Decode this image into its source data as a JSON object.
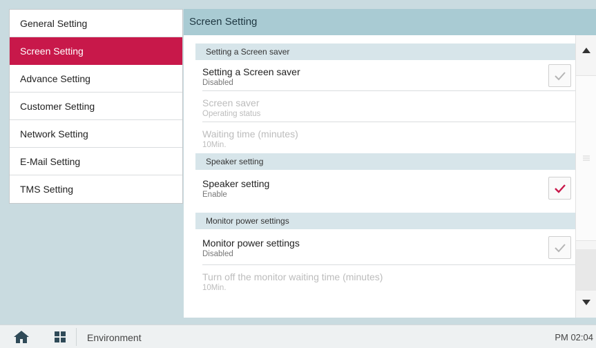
{
  "sidebar": {
    "items": [
      {
        "label": "General Setting",
        "active": false
      },
      {
        "label": "Screen Setting",
        "active": true
      },
      {
        "label": "Advance Setting",
        "active": false
      },
      {
        "label": "Customer Setting",
        "active": false
      },
      {
        "label": "Network Setting",
        "active": false
      },
      {
        "label": "E-Mail Setting",
        "active": false
      },
      {
        "label": "TMS Setting",
        "active": false
      }
    ]
  },
  "panel": {
    "title": "Screen Setting",
    "sections": [
      {
        "header": "Setting a Screen saver",
        "rows": [
          {
            "title": "Setting a Screen saver",
            "sub": "Disabled",
            "checkbox": true,
            "checked": false,
            "enabled": true
          },
          {
            "title": "Screen saver",
            "sub": "Operating status",
            "checkbox": false,
            "enabled": false
          },
          {
            "title": "Waiting time (minutes)",
            "sub": "10Min.",
            "checkbox": false,
            "enabled": false
          }
        ]
      },
      {
        "header": "Speaker setting",
        "rows": [
          {
            "title": "Speaker setting",
            "sub": "Enable",
            "checkbox": true,
            "checked": true,
            "enabled": true
          }
        ]
      },
      {
        "header": "Monitor power settings",
        "rows": [
          {
            "title": "Monitor power settings",
            "sub": "Disabled",
            "checkbox": true,
            "checked": false,
            "enabled": true
          },
          {
            "title": "Turn off the monitor waiting time (minutes)",
            "sub": "10Min.",
            "checkbox": false,
            "enabled": false
          }
        ]
      }
    ]
  },
  "bottombar": {
    "home_icon": "home-icon",
    "apps_icon": "grid-icon",
    "location": "Environment",
    "time": "PM 02:04"
  },
  "colors": {
    "accent": "#c8184a",
    "header_bg": "#a9cbd3",
    "section_bg": "#d7e5ea",
    "background": "#c9dbe0"
  }
}
